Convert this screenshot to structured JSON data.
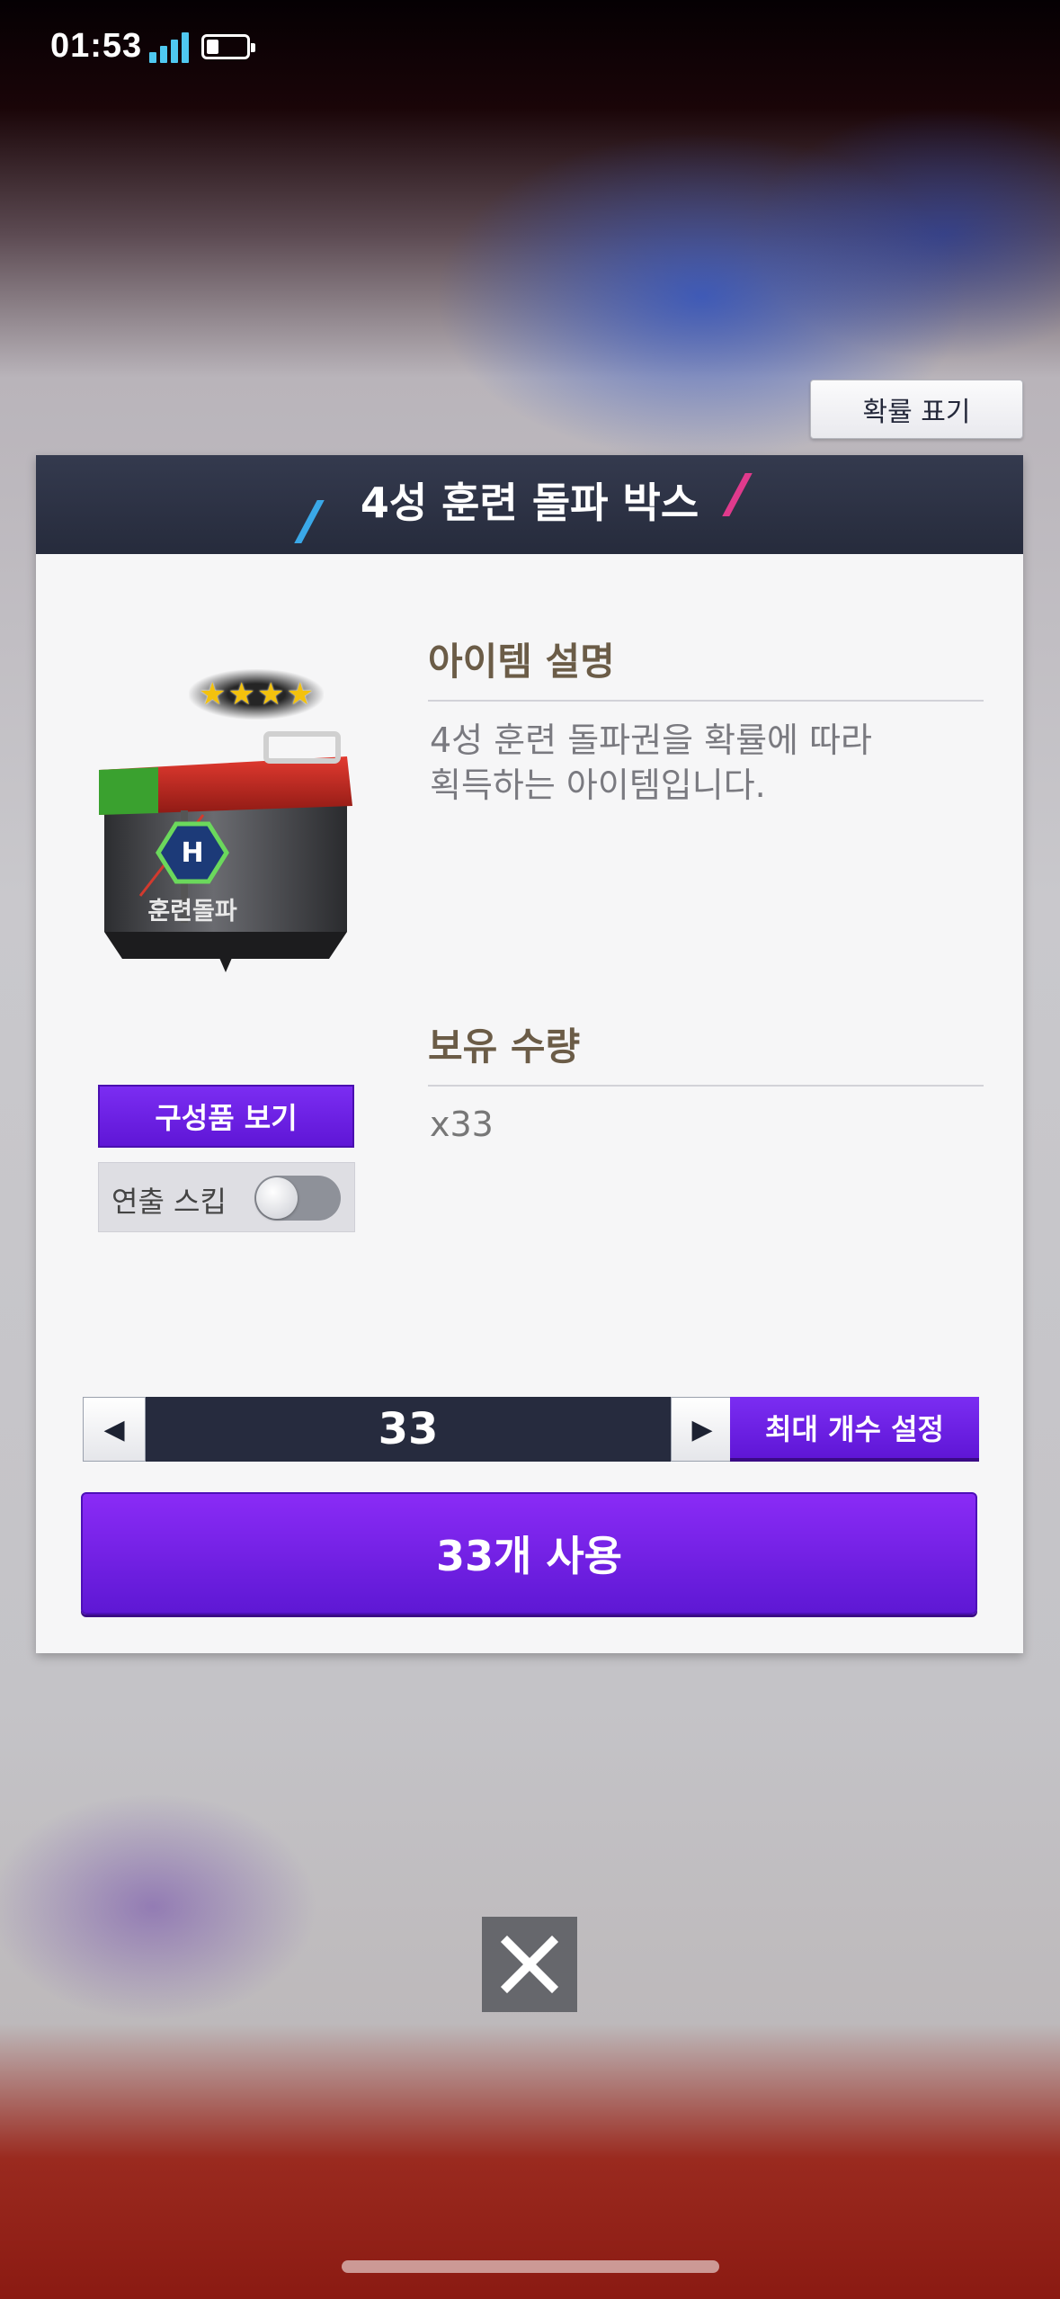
{
  "status_bar": {
    "time": "01:53",
    "battery_level": 0.3
  },
  "odds_button": {
    "label": "확률 표기"
  },
  "dialog": {
    "title": "4성 훈련 돌파 박스",
    "item": {
      "stars": [
        "★",
        "★",
        "★",
        "★"
      ],
      "image_label": "훈련돌파",
      "star_count": 4
    },
    "components_button": {
      "label": "구성품 보기"
    },
    "skip_animation": {
      "label": "연출 스킵",
      "enabled": false
    },
    "description": {
      "heading": "아이템 설명",
      "line1": "4성 훈련 돌파권을 확률에 따라",
      "line2": "획득하는 아이템입니다."
    },
    "owned": {
      "heading": "보유 수량",
      "value": "x33"
    },
    "quantity": {
      "value": "33",
      "decrement_icon": "left-triangle",
      "increment_icon": "right-triangle"
    },
    "max_button": {
      "label": "최대 개수 설정"
    },
    "use_button": {
      "label": "33개 사용"
    }
  },
  "close_button": {
    "icon": "close-icon"
  },
  "colors": {
    "accent_purple": "#6a1fe0",
    "header_navy": "#2b3043",
    "heading_brown": "#6b5c47"
  }
}
